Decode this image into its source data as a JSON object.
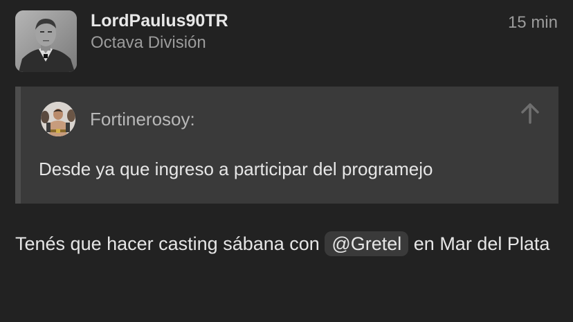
{
  "post": {
    "author": {
      "username": "LordPaulus90TR",
      "usergroup": "Octava División",
      "avatar_icon": "user-avatar-portrait"
    },
    "timestamp": "15 min",
    "quote": {
      "author_label": "Fortinerosoy:",
      "avatar_icon": "user-avatar-portrait",
      "text": "Desde ya que ingreso a participar del programejo",
      "jump_icon": "arrow-up-icon"
    },
    "body": {
      "text_before": "Tenés que hacer casting sábana con",
      "mention": "@Gretel",
      "text_after": "en Mar del Plata"
    }
  },
  "colors": {
    "background": "#222222",
    "quote_background": "#3a3a3a",
    "quote_border": "#4d4d4d",
    "muted_text": "#9c9c9c",
    "primary_text": "#e6e6e6"
  }
}
